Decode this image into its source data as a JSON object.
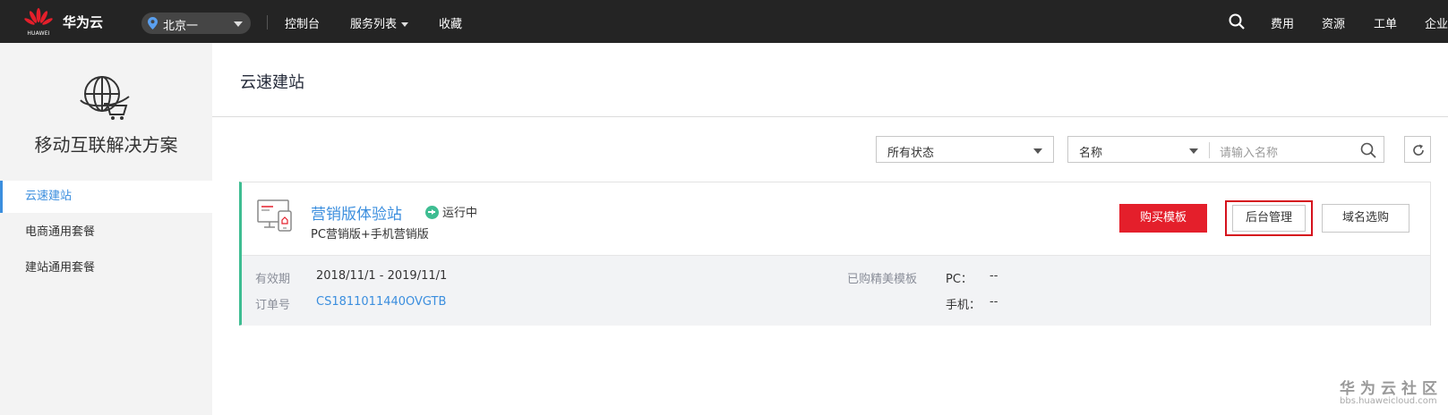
{
  "topbar": {
    "logo_text": "HUAWEI",
    "brand": "华为云",
    "region": "北京一",
    "nav": {
      "console": "控制台",
      "services": "服务列表",
      "favorites": "收藏"
    },
    "right": {
      "fees": "费用",
      "resources": "资源",
      "tickets": "工单",
      "enterprise": "企业"
    }
  },
  "sidebar": {
    "title": "移动互联解决方案",
    "items": [
      {
        "label": "云速建站",
        "active": true
      },
      {
        "label": "电商通用套餐",
        "active": false
      },
      {
        "label": "建站通用套餐",
        "active": false
      }
    ]
  },
  "main": {
    "title": "云速建站",
    "filters": {
      "status_select": "所有状态",
      "field_select": "名称",
      "search_placeholder": "请输入名称"
    },
    "card": {
      "site_name": "营销版体验站",
      "status": "运行中",
      "subtitle": "PC营销版+手机营销版",
      "buttons": {
        "buy_template": "购买模板",
        "backend": "后台管理",
        "domain": "域名选购"
      },
      "validity_label": "有效期",
      "validity_value": "2018/11/1 - 2019/11/1",
      "order_label": "订单号",
      "order_value": "CS1811011440OVGTB",
      "templates_label": "已购精美模板",
      "pc_label": "PC：",
      "pc_value": "--",
      "mobile_label": "手机：",
      "mobile_value": "--"
    }
  },
  "watermark": {
    "title": "华为云社区",
    "url": "bbs.huaweicloud.com"
  },
  "colors": {
    "topbar_bg": "#242424",
    "accent_blue": "#3b8ede",
    "buy_red": "#e41f2b",
    "running_green": "#3ebd92",
    "highlight_red": "#d5121d"
  }
}
